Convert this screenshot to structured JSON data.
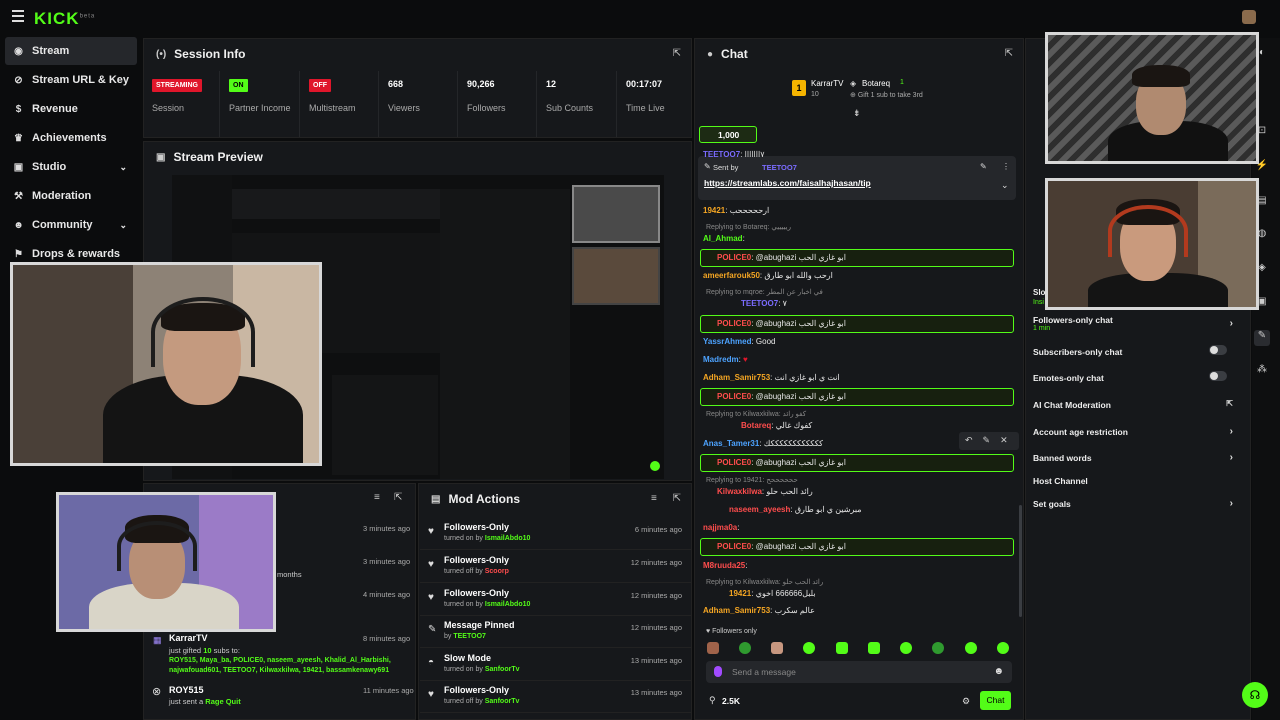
{
  "brand": {
    "logo": "KICK",
    "logo_sup": "beta"
  },
  "sidebar": {
    "items": [
      {
        "label": "Stream",
        "icon": "broadcast-icon"
      },
      {
        "label": "Stream URL & Key",
        "icon": "link-icon"
      },
      {
        "label": "Revenue",
        "icon": "dollar-icon"
      },
      {
        "label": "Achievements",
        "icon": "trophy-icon"
      },
      {
        "label": "Studio",
        "icon": "video-icon"
      },
      {
        "label": "Moderation",
        "icon": "shield-icon"
      },
      {
        "label": "Community",
        "icon": "community-icon"
      },
      {
        "label": "Drops & rewards",
        "icon": "gift-icon"
      }
    ]
  },
  "session": {
    "title": "Session Info",
    "stats": [
      {
        "badge": "STREAMING",
        "label": "Session",
        "color": "#e0162b"
      },
      {
        "badge": "ON",
        "label": "Partner Income",
        "color": "#53fc18"
      },
      {
        "badge": "OFF",
        "label": "Multistream",
        "color": "#e0162b"
      },
      {
        "value": "668",
        "label": "Viewers"
      },
      {
        "value": "90,266",
        "label": "Followers"
      },
      {
        "value": "12",
        "label": "Sub Counts"
      },
      {
        "value": "00:17:07",
        "label": "Time Live"
      }
    ]
  },
  "preview": {
    "title": "Stream Preview"
  },
  "activity": {
    "times": [
      "3 minutes ago",
      "3 minutes ago",
      "4 minutes ago",
      "8 minutes ago",
      "11 minutes ago"
    ],
    "fragment": "months",
    "gift": {
      "user": "KarrarTV",
      "text_pre": "just gifted",
      "count": "10",
      "text_post": "subs to:",
      "recipients": "ROY515, Maya_ba, POLICE0, naseem_ayeesh, Khalid_Al_Harbishi, najwafouad601, TEETOO7, Kilwaxkilwa, 19421, bassamkenawy691"
    },
    "quit": {
      "user": "ROY515",
      "text": "just sent a",
      "item": "Rage Quit"
    }
  },
  "mod_actions": {
    "title": "Mod Actions",
    "rows": [
      {
        "title": "Followers-Only",
        "sub": "turned on by",
        "user": "IsmailAbdo10",
        "time": "6 minutes ago",
        "icon": "heart-icon"
      },
      {
        "title": "Followers-Only",
        "sub": "turned off by",
        "user": "Scoorp",
        "time": "12 minutes ago",
        "icon": "heart-icon"
      },
      {
        "title": "Followers-Only",
        "sub": "turned on by",
        "user": "IsmailAbdo10",
        "time": "12 minutes ago",
        "icon": "heart-icon"
      },
      {
        "title": "Message Pinned",
        "sub": "by",
        "user": "TEETOO7",
        "time": "12 minutes ago",
        "icon": "pin-icon"
      },
      {
        "title": "Slow Mode",
        "sub": "turned on by",
        "user": "SanfoorTv",
        "time": "13 minutes ago",
        "icon": "slow-icon"
      },
      {
        "title": "Followers-Only",
        "sub": "turned off by",
        "user": "SanfoorTv",
        "time": "13 minutes ago",
        "icon": "heart-icon"
      }
    ]
  },
  "chat": {
    "title": "Chat",
    "leaderboard": {
      "first": "KarrarTV",
      "first_count": "10",
      "second": "Botareq",
      "second_count": "1",
      "gift_text": "Gift 1 sub to take 3rd"
    },
    "kicks": "1,000",
    "pinned": {
      "sent_by": "Sent by",
      "user": "TEETOO7",
      "link": "https://streamlabs.com/faisalhajhasan/tip"
    },
    "messages": [
      {
        "user": "TEETOO7",
        "text": ": ٧ااااااا",
        "color": "#7b6cff"
      },
      {
        "user": "19421",
        "text": ": ارحححححب",
        "color": "#f5a623"
      },
      {
        "reply": "Replying to Botareq: ريييييي"
      },
      {
        "user": "Al_Ahmad",
        "text": ":",
        "color": "#53fc18"
      },
      {
        "user": "POLICE0",
        "text": ": @abughazi ابو غازي الحب",
        "color": "#ff4d4d",
        "hl": true
      },
      {
        "user": "ameerfarouk50",
        "text": ": ارحب والله ابو طارق",
        "color": "#f5a623"
      },
      {
        "reply": "Replying to mqroe: في اخبار عن المطر"
      },
      {
        "user": "TEETOO7",
        "text": ": ٧",
        "color": "#7b6cff"
      },
      {
        "user": "POLICE0",
        "text": ": @abughazi ابو غازي الحب",
        "color": "#ff4d4d",
        "hl": true
      },
      {
        "user": "YassrAhmed",
        "text": ": Good",
        "color": "#4da3ff"
      },
      {
        "user": "Madredm",
        "text": ":",
        "color": "#4da3ff"
      },
      {
        "user": "Adham_Samir753",
        "text": ": انت ي ابو غازي انت",
        "color": "#f5a623"
      },
      {
        "user": "POLICE0",
        "text": ": @abughazi ابو غازي الحب",
        "color": "#ff4d4d",
        "hl": true
      },
      {
        "reply": "Replying to Kilwaxkilwa: كفو رائد"
      },
      {
        "user": "Botareq",
        "text": ": كفوك غالي",
        "color": "#ff4d4d"
      },
      {
        "user": "Anas_Tamer31",
        "text": ": ككككككككككككك",
        "color": "#4da3ff"
      },
      {
        "user": "POLICE0",
        "text": ": @abughazi ابو غازي الحب",
        "color": "#ff4d4d",
        "hl": true
      },
      {
        "reply": "Replying to 19421: ححححححح"
      },
      {
        "user": "Kilwaxkilwa",
        "text": ": رائد الحب حلو",
        "color": "#ff4d4d"
      },
      {
        "user": "naseem_ayeesh",
        "text": ": مبرشين ي ابو طارق",
        "color": "#ff4d4d"
      },
      {
        "user": "najjma0a",
        "text": ":",
        "color": "#ff4d4d"
      },
      {
        "user": "POLICE0",
        "text": ": @abughazi ابو غازي الحب",
        "color": "#ff4d4d",
        "hl": true
      },
      {
        "user": "M8ruuda25",
        "text": ":",
        "color": "#ff4d4d"
      },
      {
        "reply": "Replying to Kilwaxkilwa: رائد الحب حلو"
      },
      {
        "user": "19421",
        "text": ": بلبل666666 اخوي",
        "color": "#f5a623"
      },
      {
        "user": "Adham_Samir753",
        "text": ": عالم سكرب",
        "color": "#f5a623"
      }
    ],
    "followers_only": "Followers only",
    "input_placeholder": "Send a message",
    "viewers": "2.5K",
    "send": "Chat"
  },
  "settings": {
    "rows": [
      {
        "label": "Followers-only chat",
        "sub": "1 min",
        "type": "arrow"
      },
      {
        "label": "Subscribers-only chat",
        "type": "toggle"
      },
      {
        "label": "Emotes-only chat",
        "type": "toggle"
      },
      {
        "label": "AI Chat Moderation",
        "type": "external"
      },
      {
        "label": "Account age restriction",
        "type": "arrow"
      },
      {
        "label": "Banned words",
        "type": "arrow"
      },
      {
        "label": "Host Channel",
        "type": "none"
      },
      {
        "label": "Set goals",
        "type": "arrow"
      }
    ],
    "fragment_a": "Slo",
    "fragment_b": "Insi"
  },
  "colors": {
    "accent": "#53fc18",
    "live": "#e0162b",
    "panel": "#16181b"
  }
}
